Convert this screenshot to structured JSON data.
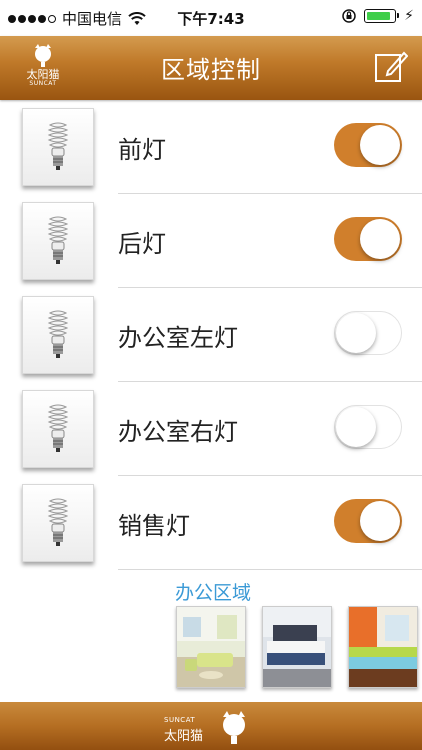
{
  "status_bar": {
    "carrier": "中国电信",
    "time": "下午7:43"
  },
  "header": {
    "title": "区域控制",
    "logo_cn": "太阳猫",
    "logo_en": "SUNCAT",
    "brand_color": "#c07a2a"
  },
  "lights": [
    {
      "label": "前灯",
      "on": true
    },
    {
      "label": "后灯",
      "on": true
    },
    {
      "label": "办公室左灯",
      "on": false
    },
    {
      "label": "办公室右灯",
      "on": false
    },
    {
      "label": "销售灯",
      "on": true
    }
  ],
  "area": {
    "title": "办公区域",
    "thumbnails": [
      "living-room-image",
      "bedroom-image",
      "bedroom-image"
    ]
  },
  "footer": {
    "logo_en": "SUNCAT",
    "logo_cn": "太阳猫"
  },
  "colors": {
    "toggle_on": "#d07f2c",
    "area_title": "#3b9ad6"
  }
}
